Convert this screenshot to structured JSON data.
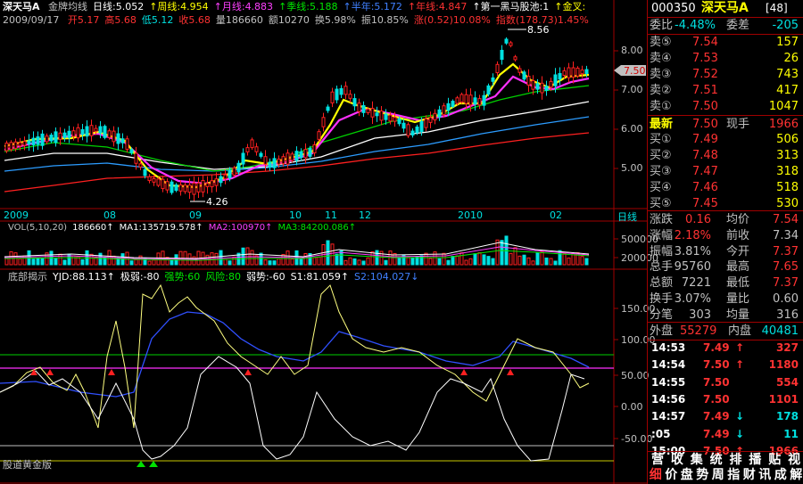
{
  "main_header": {
    "name": "深天马A",
    "items": [
      {
        "text": "金牌均线",
        "color": "#c0c0c0"
      },
      {
        "text": "日线:5.052",
        "color": "#ffffff"
      },
      {
        "text": "↑周线:4.954",
        "color": "#ffff00"
      },
      {
        "text": "↑月线:4.883",
        "color": "#ff40ff"
      },
      {
        "text": "↑季线:5.188",
        "color": "#00e600"
      },
      {
        "text": "↑半年:5.172",
        "color": "#4080ff"
      },
      {
        "text": "↑年线:4.847",
        "color": "#ff3232"
      },
      {
        "text": "↑第一黑马股池:1",
        "color": "#ffffff"
      },
      {
        "text": "↑金叉:",
        "color": "#ffff00"
      }
    ]
  },
  "price_header": {
    "date": "2009/09/17",
    "items": [
      {
        "text": "开5.17",
        "color": "#ff3232"
      },
      {
        "text": "高5.68",
        "color": "#ff3232"
      },
      {
        "text": "低5.12",
        "color": "#00e0e0"
      },
      {
        "text": "收5.68",
        "color": "#ff3232"
      },
      {
        "text": "量186660",
        "color": "#c0c0c0"
      },
      {
        "text": "额10270",
        "color": "#c0c0c0"
      },
      {
        "text": "换5.98%",
        "color": "#c0c0c0"
      },
      {
        "text": "振10.85%",
        "color": "#c0c0c0"
      },
      {
        "text": "涨(0.52)10.08%",
        "color": "#ff3232"
      },
      {
        "text": "指数(178.73)1.45%",
        "color": "#ff3232"
      }
    ]
  },
  "price_axis": [
    "8.00",
    "7.00",
    "6.00",
    "5.00"
  ],
  "current_price_tag": "7.50",
  "high_label": "8.56",
  "low_label": "4.26",
  "date_axis": {
    "labels": [
      "2009",
      "08",
      "09",
      "10",
      "11",
      "12",
      "2010",
      "02"
    ],
    "period": "日线"
  },
  "volume_header": {
    "items": [
      {
        "text": "VOL(5,10,20)",
        "color": "#c0c0c0"
      },
      {
        "text": "186660↑",
        "color": "#ffffff"
      },
      {
        "text": "MA1:135719.578↑",
        "color": "#ffffff"
      },
      {
        "text": "MA2:100970↑",
        "color": "#ff40ff"
      },
      {
        "text": "MA3:84200.086↑",
        "color": "#00e600"
      }
    ]
  },
  "volume_axis": [
    "500000",
    "200000"
  ],
  "indicator_header": {
    "items": [
      {
        "text": "底部揭示",
        "color": "#c0c0c0"
      },
      {
        "text": "YJD:88.113↑",
        "color": "#ffffff"
      },
      {
        "text": "极弱:-80",
        "color": "#ffffff"
      },
      {
        "text": "强势:60",
        "color": "#00e600"
      },
      {
        "text": "风险:80",
        "color": "#00e600"
      },
      {
        "text": "弱势:-60",
        "color": "#ffffff"
      },
      {
        "text": "S1:81.059↑",
        "color": "#ffffff"
      },
      {
        "text": "S2:104.027↓",
        "color": "#4080ff"
      }
    ]
  },
  "indicator_axis": [
    "150.00",
    "100.00",
    "50.00",
    "0.00",
    "-50.00"
  ],
  "indicator_footer": "股道黄金版",
  "quote": {
    "code": "000350",
    "name": "深天马A",
    "count": "[48]",
    "weibi_label": "委比",
    "weibi_value": "-4.48%",
    "weicha_label": "委差",
    "weicha_value": "-205",
    "sells": [
      {
        "label": "卖⑤",
        "price": "7.54",
        "vol": "157"
      },
      {
        "label": "卖④",
        "price": "7.53",
        "vol": "26"
      },
      {
        "label": "卖③",
        "price": "7.52",
        "vol": "743"
      },
      {
        "label": "卖②",
        "price": "7.51",
        "vol": "417"
      },
      {
        "label": "卖①",
        "price": "7.50",
        "vol": "1047"
      }
    ],
    "latest": {
      "label": "最新",
      "price": "7.50",
      "hand_label": "现手",
      "hand": "1966"
    },
    "buys": [
      {
        "label": "买①",
        "price": "7.49",
        "vol": "506"
      },
      {
        "label": "买②",
        "price": "7.48",
        "vol": "313"
      },
      {
        "label": "买③",
        "price": "7.47",
        "vol": "318"
      },
      {
        "label": "买④",
        "price": "7.46",
        "vol": "518"
      },
      {
        "label": "买⑤",
        "price": "7.45",
        "vol": "530"
      }
    ],
    "stats": [
      {
        "l1": "涨跌",
        "v1": "0.16",
        "c1": "#ff3232",
        "l2": "均价",
        "v2": "7.54",
        "c2": "#ff3232"
      },
      {
        "l1": "涨幅",
        "v1": "2.18%",
        "c1": "#ff3232",
        "l2": "前收",
        "v2": "7.34",
        "c2": "#c0c0c0"
      },
      {
        "l1": "振幅",
        "v1": "3.81%",
        "c1": "#c0c0c0",
        "l2": "今开",
        "v2": "7.37",
        "c2": "#ff3232"
      },
      {
        "l1": "总手",
        "v1": "95760",
        "c1": "#c0c0c0",
        "l2": "最高",
        "v2": "7.65",
        "c2": "#ff3232"
      },
      {
        "l1": "总额",
        "v1": "7221",
        "c1": "#c0c0c0",
        "l2": "最低",
        "v2": "7.37",
        "c2": "#ff3232"
      },
      {
        "l1": "换手",
        "v1": "3.07%",
        "c1": "#c0c0c0",
        "l2": "量比",
        "v2": "0.60",
        "c2": "#c0c0c0"
      },
      {
        "l1": "分笔",
        "v1": "303",
        "c1": "#c0c0c0",
        "l2": "均量",
        "v2": "316",
        "c2": "#c0c0c0"
      }
    ],
    "outer_label": "外盘",
    "outer_value": "55279",
    "inner_label": "内盘",
    "inner_value": "40481",
    "ticks": [
      {
        "time": "14:53",
        "price": "7.49",
        "arrow": "↑",
        "vol": "327",
        "pc": "#ff3232",
        "vc": "#ff3232"
      },
      {
        "time": "14:54",
        "price": "7.50",
        "arrow": "↑",
        "vol": "1180",
        "pc": "#ff3232",
        "vc": "#ff3232"
      },
      {
        "time": "14:55",
        "price": "7.50",
        "arrow": "",
        "vol": "554",
        "pc": "#ff3232",
        "vc": "#ff3232"
      },
      {
        "time": "14:56",
        "price": "7.50",
        "arrow": "",
        "vol": "1101",
        "pc": "#ff3232",
        "vc": "#ff3232"
      },
      {
        "time": "14:57",
        "price": "7.49",
        "arrow": "↓",
        "vol": "178",
        "pc": "#ff3232",
        "vc": "#00e0e0"
      },
      {
        "time": ":05",
        "price": "7.49",
        "arrow": "↓",
        "vol": "11",
        "pc": "#ff3232",
        "vc": "#00e0e0"
      },
      {
        "time": "15:00",
        "price": "7.50",
        "arrow": "↑",
        "vol": "1966",
        "pc": "#ff3232",
        "vc": "#ff3232"
      }
    ],
    "bottom_tabs_1": [
      "营",
      "收",
      "集",
      "统",
      "排",
      "播",
      "贴",
      "视"
    ],
    "bottom_tabs_2": [
      "细",
      "价",
      "盘",
      "势",
      "周",
      "指",
      "财",
      "讯",
      "成",
      "解"
    ]
  }
}
